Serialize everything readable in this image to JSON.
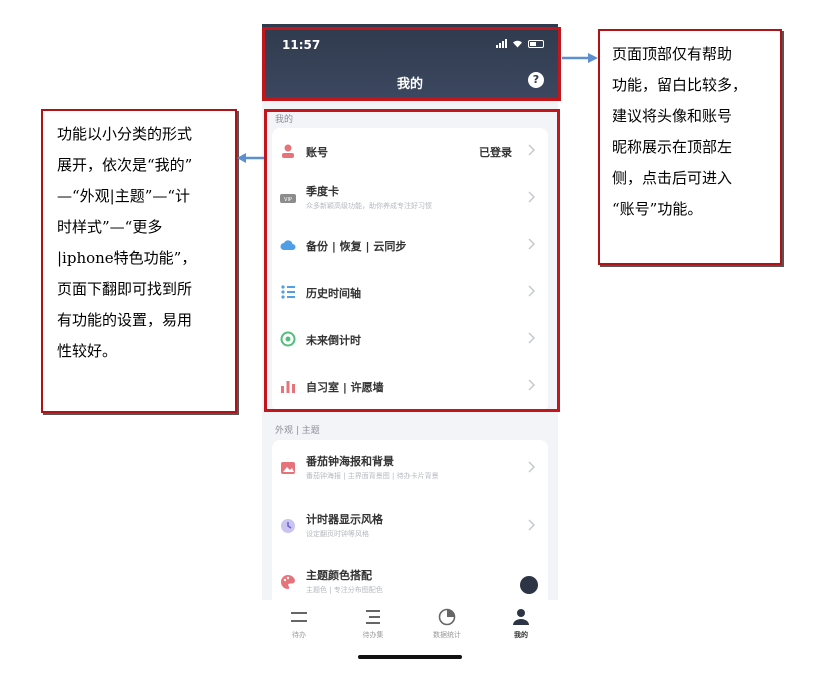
{
  "phone": {
    "status_time": "11:57",
    "page_title": "我的",
    "help_icon_glyph": "?",
    "sections": [
      {
        "label": "我的",
        "items": [
          {
            "label": "账号",
            "value": "已登录",
            "icon": "user-icon",
            "color": "#e8727a"
          },
          {
            "label": "季度卡",
            "sub": "众多新颖高级功能，助你养成专注好习惯",
            "icon": "vip-icon",
            "badge": "VIP",
            "color": "#8c8c8c"
          },
          {
            "label": "备份 | 恢复 | 云同步",
            "icon": "cloud-icon",
            "color": "#4f9ee6"
          },
          {
            "label": "历史时间轴",
            "icon": "timeline-icon",
            "color": "#4f9ee6"
          },
          {
            "label": "未来倒计时",
            "icon": "target-icon",
            "color": "#4fbf7a"
          },
          {
            "label": "自习室 | 许愿墙",
            "icon": "bar-chart-icon",
            "color": "#e8727a"
          }
        ]
      },
      {
        "label": "外观 | 主题",
        "items": [
          {
            "label": "番茄钟海报和背景",
            "sub": "番茄钟海报 | 主界面背景图 | 待办卡片背景",
            "icon": "image-icon",
            "color": "#e8727a"
          },
          {
            "label": "计时器显示风格",
            "sub": "设定翻页时钟等风格",
            "icon": "clock-icon",
            "color": "#8b7fd6"
          },
          {
            "label": "主题颜色搭配",
            "sub": "主题色 | 专注分布图配色",
            "icon": "palette-icon",
            "color": "#e8727a"
          }
        ]
      }
    ],
    "tabs": [
      {
        "label": "待办",
        "icon": "todo-icon",
        "active": false
      },
      {
        "label": "待办集",
        "icon": "todo-set-icon",
        "active": false
      },
      {
        "label": "数据统计",
        "icon": "pie-chart-icon",
        "active": false
      },
      {
        "label": "我的",
        "icon": "profile-icon",
        "active": true
      }
    ]
  },
  "notes": {
    "left": [
      "功能以小分类的形式",
      "展开，依次是“我的”",
      "—“外观|主题”—“计",
      "时样式”—“更多",
      "|iphone特色功能”，",
      "页面下翻即可找到所",
      "有功能的设置，易用",
      "性较好。"
    ],
    "right": [
      "页面顶部仅有帮助",
      "功能，留白比较多，",
      "建议将头像和账号",
      "昵称展示在顶部左",
      "侧，点击后可进入",
      "“账号”功能。"
    ]
  },
  "colors": {
    "annotation_red": "#c0161c",
    "arrow_blue": "#5b8fd0",
    "topbar": "#2f3a4d"
  }
}
